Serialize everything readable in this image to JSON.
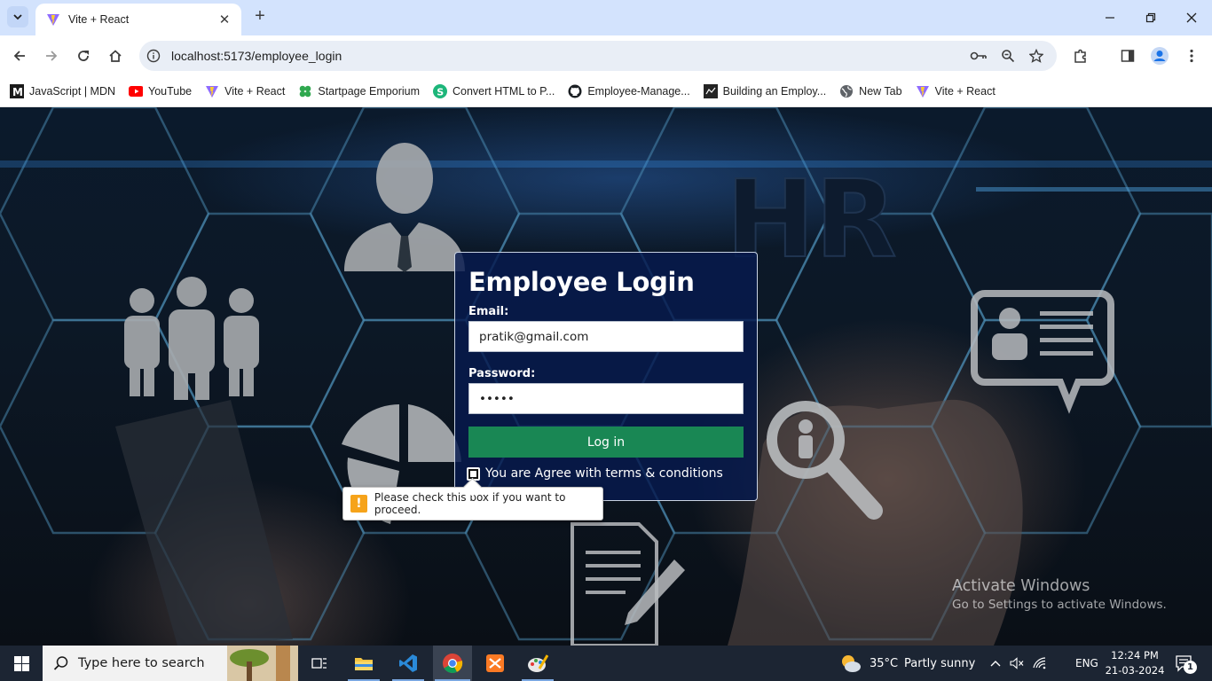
{
  "browser": {
    "tab": {
      "title": "Vite + React"
    },
    "address": {
      "url": "localhost:5173/employee_login"
    },
    "bookmarks": [
      {
        "label": "JavaScript | MDN",
        "icon": "mdn-icon"
      },
      {
        "label": "YouTube",
        "icon": "youtube-icon"
      },
      {
        "label": "Vite + React",
        "icon": "vite-icon"
      },
      {
        "label": "Startpage Emporium",
        "icon": "clover-icon"
      },
      {
        "label": "Convert HTML to P...",
        "icon": "convert-icon"
      },
      {
        "label": "Employee-Manage...",
        "icon": "github-icon"
      },
      {
        "label": "Building an Employ...",
        "icon": "article-icon"
      },
      {
        "label": "New Tab",
        "icon": "globe-icon"
      },
      {
        "label": "Vite + React",
        "icon": "vite-icon"
      }
    ]
  },
  "login": {
    "heading": "Employee Login",
    "email_label": "Email:",
    "email_value": "pratik@gmail.com",
    "password_label": "Password:",
    "password_value": "•••••",
    "submit_label": "Log in",
    "terms_label": "You are Agree with terms & conditions",
    "validation_message": "Please check this box if you want to proceed."
  },
  "background": {
    "hr_text": "HR"
  },
  "watermark": {
    "title": "Activate Windows",
    "subtitle": "Go to Settings to activate Windows."
  },
  "taskbar": {
    "search_placeholder": "Type here to search",
    "weather_temp": "35°C",
    "weather_desc": "Partly sunny",
    "language": "ENG",
    "time": "12:24 PM",
    "date": "21-03-2024",
    "notification_count": "1"
  },
  "colors": {
    "tabstrip": "#d3e3fd",
    "login_button": "#198754",
    "card_bg": "#061a4e",
    "taskbar": "#1c2533",
    "warning": "#f6a31a"
  }
}
